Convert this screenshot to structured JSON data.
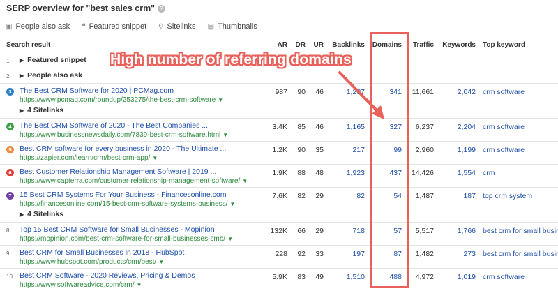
{
  "header": {
    "title": "SERP overview for \"best sales crm\"",
    "help_icon": "?"
  },
  "features": [
    {
      "icon": "people-icon",
      "label": "People also ask"
    },
    {
      "icon": "quote-icon",
      "label": "Featured snippet"
    },
    {
      "icon": "link-icon",
      "label": "Sitelinks"
    },
    {
      "icon": "image-icon",
      "label": "Thumbnails"
    }
  ],
  "columns": {
    "search_result": "Search result",
    "ar": "AR",
    "dr": "DR",
    "ur": "UR",
    "backlinks": "Backlinks",
    "domains": "Domains",
    "traffic": "Traffic",
    "keywords": "Keywords",
    "top_keyword": "Top keyword"
  },
  "serp_features": [
    {
      "pos": "1",
      "label": "Featured snippet"
    },
    {
      "pos": "2",
      "label": "People also ask"
    }
  ],
  "sitelinks_label": "4 Sitelinks",
  "results": [
    {
      "pos": "3",
      "badge_color": "#2a7fc4",
      "title": "The Best CRM Software for 2020 | PCMag.com",
      "url": "https://www.pcmag.com/roundup/253275/the-best-crm-software",
      "ar": "987",
      "dr": "90",
      "ur": "46",
      "backlinks": "1,287",
      "domains": "341",
      "traffic": "11,661",
      "keywords": "2,042",
      "top_keyword": "crm software"
    },
    {
      "pos": "4",
      "badge_color": "#3fa14a",
      "title": "The Best CRM Software of 2020 - The Best Companies ...",
      "url": "https://www.businessnewsdaily.com/7839-best-crm-software.html",
      "ar": "3.4K",
      "dr": "85",
      "ur": "46",
      "backlinks": "1,165",
      "domains": "327",
      "traffic": "6,237",
      "keywords": "2,204",
      "top_keyword": "crm software"
    },
    {
      "pos": "5",
      "badge_color": "#ef8a3c",
      "title": "Best CRM software for every business in 2020 - The Ultimate ...",
      "url": "https://zapier.com/learn/crm/best-crm-app/",
      "ar": "1.2K",
      "dr": "90",
      "ur": "35",
      "backlinks": "217",
      "domains": "99",
      "traffic": "2,960",
      "keywords": "1,199",
      "top_keyword": "crm software"
    },
    {
      "pos": "6",
      "badge_color": "#e0413c",
      "title": "Best Customer Relationship Management Software | 2019 ...",
      "url": "https://www.capterra.com/customer-relationship-management-software/",
      "ar": "1.9K",
      "dr": "88",
      "ur": "48",
      "backlinks": "1,923",
      "domains": "437",
      "traffic": "14,426",
      "keywords": "1,554",
      "top_keyword": "crm"
    },
    {
      "pos": "7",
      "badge_color": "#6f3fa3",
      "title": "15 Best CRM Systems For Your Business - Financesonline.com",
      "url": "https://financesonline.com/15-best-crm-software-systems-business/",
      "ar": "7.6K",
      "dr": "82",
      "ur": "29",
      "backlinks": "82",
      "domains": "54",
      "traffic": "1,487",
      "keywords": "187",
      "top_keyword": "top crm system"
    },
    {
      "pos": "8",
      "badge_color": "",
      "title": "Top 15 Best CRM Software for Small Businesses - Mopinion",
      "url": "https://mopinion.com/best-crm-software-for-small-businesses-smb/",
      "ar": "132K",
      "dr": "66",
      "ur": "29",
      "backlinks": "718",
      "domains": "57",
      "traffic": "5,517",
      "keywords": "1,766",
      "top_keyword": "best crm for small business"
    },
    {
      "pos": "9",
      "badge_color": "",
      "title": "Best CRM for Small Businesses in 2018 - HubSpot",
      "url": "https://www.hubspot.com/products/crm/best/",
      "ar": "228",
      "dr": "92",
      "ur": "33",
      "backlinks": "197",
      "domains": "87",
      "traffic": "1,482",
      "keywords": "273",
      "top_keyword": "best crm for small business"
    },
    {
      "pos": "10",
      "badge_color": "",
      "title": "Best CRM Software - 2020 Reviews, Pricing & Demos",
      "url": "https://www.softwareadvice.com/crm/",
      "ar": "5.9K",
      "dr": "83",
      "ur": "49",
      "backlinks": "1,510",
      "domains": "488",
      "traffic": "4,972",
      "keywords": "1,019",
      "top_keyword": "crm software"
    }
  ],
  "annotation": {
    "text": "High number of referring domains",
    "color": "#e8615a"
  }
}
